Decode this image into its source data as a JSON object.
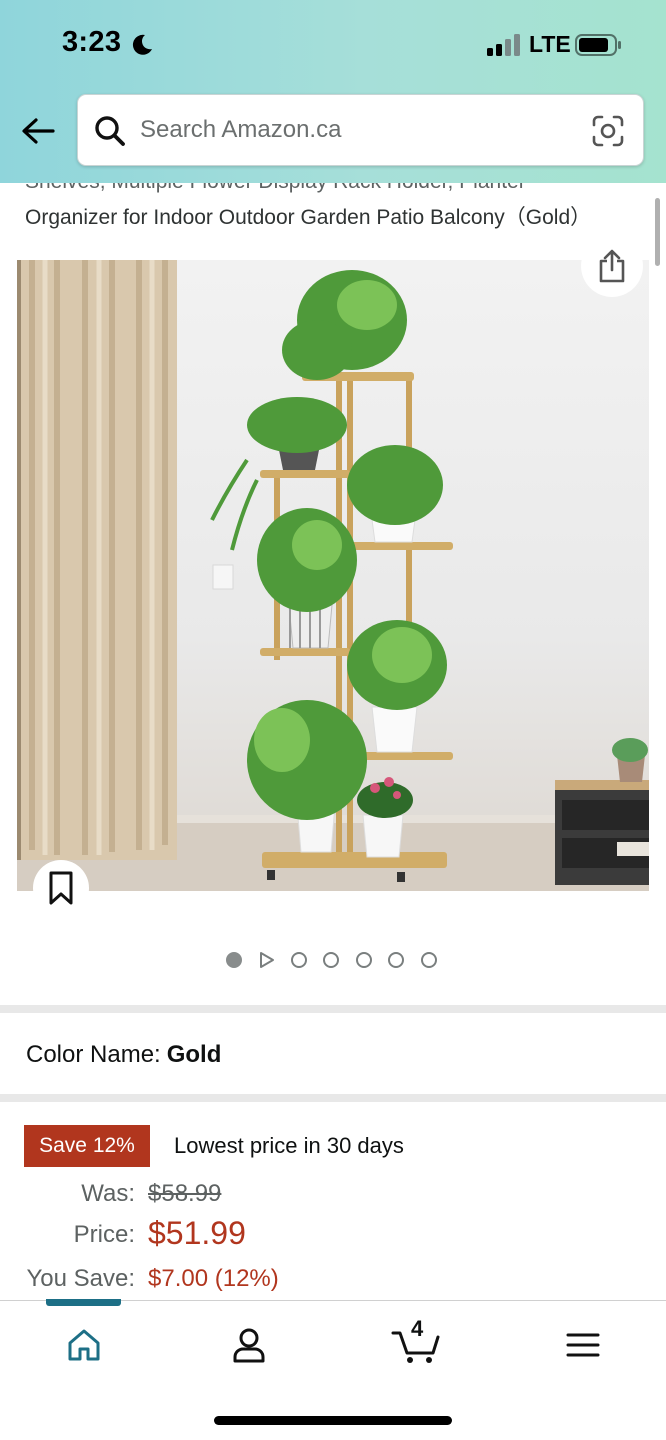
{
  "status_bar": {
    "time": "3:23",
    "network": "LTE"
  },
  "search": {
    "placeholder": "Search Amazon.ca"
  },
  "product": {
    "title_line1": "Shelves, Multiple Flower Display Rack Holder, Planter",
    "title_line2": "Organizer for Indoor Outdoor Garden Patio Balcony（Gold）",
    "image_count": 7,
    "active_image_index": 0
  },
  "variant": {
    "label": "Color Name:",
    "value": "Gold"
  },
  "pricing": {
    "save_badge": "Save 12%",
    "lowest_text": "Lowest price in 30 days",
    "was_label": "Was:",
    "was_value": "$58.99",
    "price_label": "Price:",
    "price_value": "$51.99",
    "you_save_label": "You Save:",
    "you_save_value": "$7.00 (12%)"
  },
  "tabbar": {
    "cart_count": "4",
    "active_tab": "home"
  },
  "colors": {
    "header_bg": "#a6dfd9",
    "accent_red": "#b1361e",
    "tab_active": "#1d6f86"
  }
}
